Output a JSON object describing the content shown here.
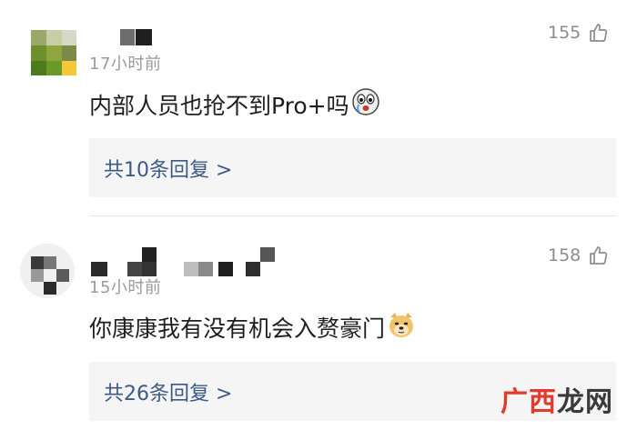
{
  "comments": [
    {
      "time": "17小时前",
      "likes": "155",
      "text": "内部人员也抢不到Pro+吗",
      "replies": "共10条回复 >"
    },
    {
      "time": "15小时前",
      "likes": "158",
      "text": "你康康我有没有机会入赘豪门",
      "replies": "共26条回复 >"
    }
  ],
  "watermark": {
    "part1": "广",
    "part2": "西",
    "part3": "龙网"
  },
  "colors": {
    "reply_link": "#3d5a86",
    "reply_bg": "#f5f5f5",
    "muted": "#9a9a9a",
    "watermark_red": "#e23b2e"
  }
}
